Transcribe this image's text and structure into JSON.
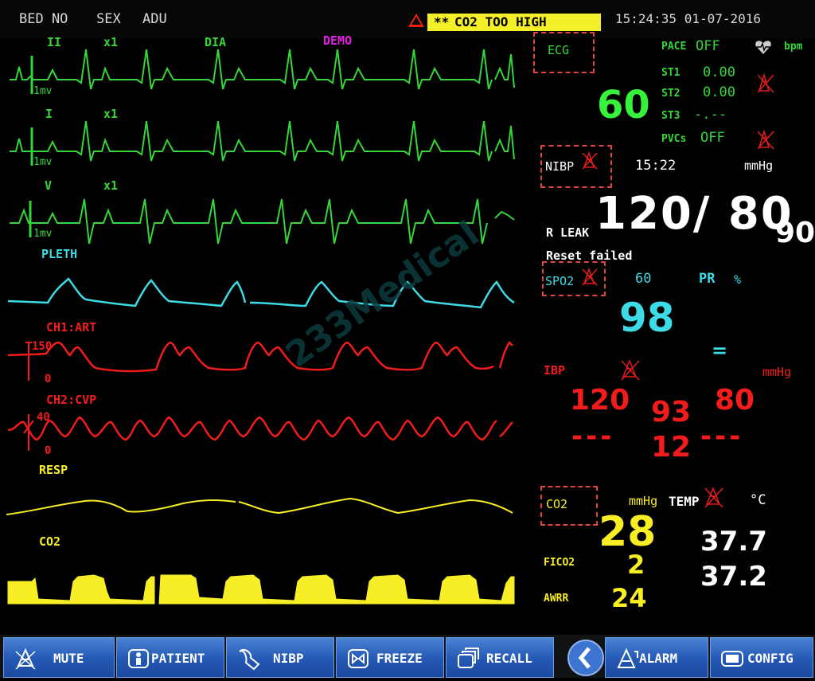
{
  "topbar": {
    "bed": "BED NO",
    "sex": "SEX",
    "type": "ADU",
    "alarm_prefix": "**",
    "alarm_message": "CO2 TOO HIGH",
    "datetime": "15:24:35 01-07-2016"
  },
  "waves": {
    "ii_label": "II",
    "ii_gain": "x1",
    "ii_filter": "DIA",
    "demo": "DEMO",
    "ii_scale": "1mv",
    "i_label": "I",
    "i_gain": "x1",
    "i_scale": "1mv",
    "v_label": "V",
    "v_gain": "x1",
    "v_scale": "1mv",
    "pleth_label": "PLETH",
    "art_label": "CH1:ART",
    "art_top": "150",
    "art_bottom": "0",
    "cvp_label": "CH2:CVP",
    "cvp_top": "40",
    "cvp_bottom": "0",
    "resp_label": "RESP",
    "co2_label": "CO2"
  },
  "params": {
    "ecg": {
      "label": "ECG",
      "hr": "60",
      "pace_label": "PACE",
      "pace_value": "OFF",
      "bpm_unit": "bpm",
      "st1_label": "ST1",
      "st1_value": "0.00",
      "st2_label": "ST2",
      "st2_value": "0.00",
      "st3_label": "ST3",
      "st3_value": "-.--",
      "pvcs_label": "PVCs",
      "pvcs_value": "OFF"
    },
    "nibp": {
      "label": "NIBP",
      "time": "15:22",
      "unit": "mmHg",
      "value": "120/ 80",
      "mean": "90",
      "leak": "R LEAK",
      "status": "Reset failed"
    },
    "spo2": {
      "label": "SPO2",
      "pr_value": "60",
      "pr_label": "PR",
      "percent": "%",
      "value": "98",
      "equals": "="
    },
    "ibp": {
      "label": "IBP",
      "unit": "mmHg",
      "sys": "120",
      "mean": "93",
      "dia": "80",
      "cvp_left": "---",
      "cvp_mean": "12",
      "cvp_right": "---"
    },
    "co2": {
      "label": "CO2",
      "unit": "mmHg",
      "value": "28",
      "fico2_label": "FICO2",
      "fico2_value": "2",
      "awrr_label": "AWRR",
      "awrr_value": "24"
    },
    "temp": {
      "label": "TEMP",
      "unit": "°C",
      "t1": "37.7",
      "t2": "37.2"
    }
  },
  "watermark": "233Medical",
  "menu": {
    "mute": "MUTE",
    "patient": "PATIENT",
    "nibp": "NIBP",
    "freeze": "FREEZE",
    "recall": "RECALL",
    "alarm": "ALARM",
    "config": "CONFIG"
  },
  "colors": {
    "ecg": "#36d63a",
    "pleth": "#3ddbe6",
    "ibp": "#f21c1c",
    "resp_co2": "#f7ee26",
    "alarm_bg": "#f4ef26",
    "button": "#2f66c4"
  }
}
